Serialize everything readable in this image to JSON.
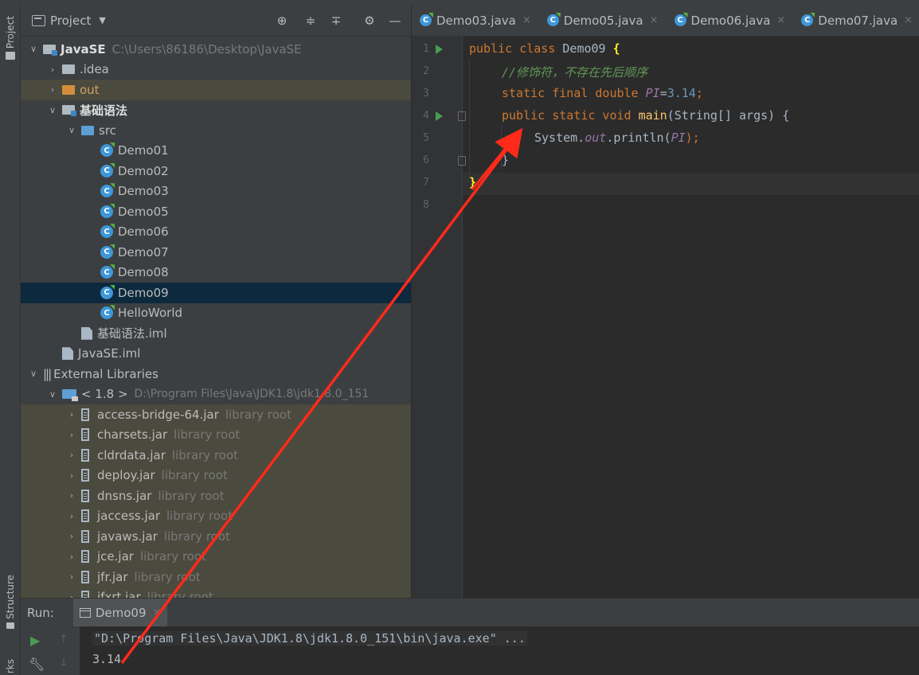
{
  "sidebar": {
    "project_tab": "Project",
    "structure_tab": "Structure",
    "bottom_tab": "rks"
  },
  "project_panel": {
    "title": "Project",
    "tree": [
      {
        "level": 0,
        "arrow": "open",
        "icon": "module-folder",
        "label": "JavaSE",
        "bold": true,
        "hint": "C:\\Users\\86186\\Desktop\\JavaSE"
      },
      {
        "level": 1,
        "arrow": "closed",
        "icon": "folder",
        "label": ".idea"
      },
      {
        "level": 1,
        "arrow": "closed",
        "icon": "folder-orange",
        "label": "out",
        "excluded": true
      },
      {
        "level": 1,
        "arrow": "open",
        "icon": "module-folder",
        "label": "基础语法",
        "bold": true
      },
      {
        "level": 2,
        "arrow": "open",
        "icon": "folder-blue",
        "label": "src"
      },
      {
        "level": 3,
        "icon": "class",
        "label": "Demo01"
      },
      {
        "level": 3,
        "icon": "class",
        "label": "Demo02"
      },
      {
        "level": 3,
        "icon": "class",
        "label": "Demo03"
      },
      {
        "level": 3,
        "icon": "class",
        "label": "Demo05"
      },
      {
        "level": 3,
        "icon": "class",
        "label": "Demo06"
      },
      {
        "level": 3,
        "icon": "class",
        "label": "Demo07"
      },
      {
        "level": 3,
        "icon": "class",
        "label": "Demo08"
      },
      {
        "level": 3,
        "icon": "class",
        "label": "Demo09",
        "selected": true
      },
      {
        "level": 3,
        "icon": "class",
        "label": "HelloWorld"
      },
      {
        "level": 2,
        "icon": "iml",
        "label": "基础语法.iml"
      },
      {
        "level": 1,
        "icon": "iml",
        "label": "JavaSE.iml"
      },
      {
        "level": 0,
        "arrow": "open",
        "icon": "libraries",
        "label": "External Libraries"
      },
      {
        "level": 1,
        "arrow": "open",
        "icon": "jdk",
        "label": "< 1.8 >",
        "hint": "D:\\Program Files\\Java\\JDK1.8\\jdk1.8.0_151",
        "hint_small": true
      },
      {
        "level": 2,
        "arrow": "closed",
        "icon": "jar",
        "label": "access-bridge-64.jar",
        "hint": "library root",
        "lib": true
      },
      {
        "level": 2,
        "arrow": "closed",
        "icon": "jar",
        "label": "charsets.jar",
        "hint": "library root",
        "lib": true
      },
      {
        "level": 2,
        "arrow": "closed",
        "icon": "jar",
        "label": "cldrdata.jar",
        "hint": "library root",
        "lib": true
      },
      {
        "level": 2,
        "arrow": "closed",
        "icon": "jar",
        "label": "deploy.jar",
        "hint": "library root",
        "lib": true
      },
      {
        "level": 2,
        "arrow": "closed",
        "icon": "jar",
        "label": "dnsns.jar",
        "hint": "library root",
        "lib": true
      },
      {
        "level": 2,
        "arrow": "closed",
        "icon": "jar",
        "label": "jaccess.jar",
        "hint": "library root",
        "lib": true
      },
      {
        "level": 2,
        "arrow": "closed",
        "icon": "jar",
        "label": "javaws.jar",
        "hint": "library root",
        "lib": true
      },
      {
        "level": 2,
        "arrow": "closed",
        "icon": "jar",
        "label": "jce.jar",
        "hint": "library root",
        "lib": true
      },
      {
        "level": 2,
        "arrow": "closed",
        "icon": "jar",
        "label": "jfr.jar",
        "hint": "library root",
        "lib": true
      },
      {
        "level": 2,
        "arrow": "closed",
        "icon": "jar",
        "label": "jfxrt.jar",
        "hint": "library root",
        "lib": true
      }
    ]
  },
  "editor": {
    "tabs": [
      {
        "label": "Demo03.java"
      },
      {
        "label": "Demo05.java"
      },
      {
        "label": "Demo06.java"
      },
      {
        "label": "Demo07.java"
      }
    ],
    "line_numbers": [
      "1",
      "2",
      "3",
      "4",
      "5",
      "6",
      "7",
      "8"
    ],
    "code": {
      "l1_kw": "public class ",
      "l1_name": "Demo09 ",
      "l1_brace": "{",
      "l2_comment": "//修饰符，不存在先后顺序",
      "l3_kw": "static final double ",
      "l3_const": "PI",
      "l3_eq": "=",
      "l3_num": "3.14",
      "l3_end": ";",
      "l4_kw": "public static void ",
      "l4_fn": "main",
      "l4_rest": "(String[] args) {",
      "l5_sys": "System.",
      "l5_out": "out",
      "l5_call": ".println(",
      "l5_const": "PI",
      "l5_end": ");",
      "l6": "}",
      "l7": "}"
    }
  },
  "run_panel": {
    "label": "Run:",
    "tab": "Demo09",
    "output": [
      "\"D:\\Program Files\\Java\\JDK1.8\\jdk1.8.0_151\\bin\\java.exe\" ...",
      "3.14"
    ]
  },
  "colors": {
    "annotation": "#ff2a1a",
    "selection": "#0d293e"
  }
}
